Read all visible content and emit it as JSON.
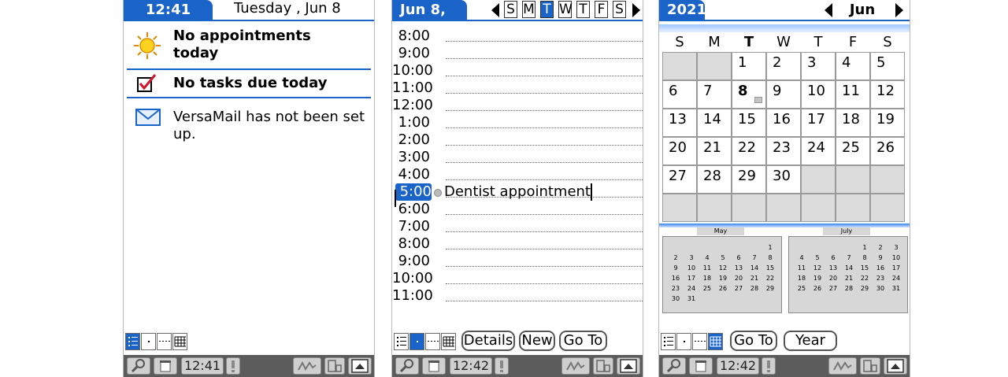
{
  "s1": {
    "time_tab": "12:41 pm",
    "date": "Tuesday , Jun 8",
    "appointments": "No appointments today",
    "appointments_l1": "No appointments",
    "appointments_l2": "today",
    "tasks": "No tasks due today",
    "mail": "VersaMail has not been set up.",
    "status_time": "12:41",
    "icons": [
      "sun-icon",
      "checkbox-icon",
      "envelope-icon"
    ]
  },
  "s2": {
    "date_tab": "Jun 8, 21",
    "week_days": [
      "S",
      "M",
      "T",
      "W",
      "T",
      "F",
      "S"
    ],
    "selected_day_index": 2,
    "hours": [
      "8:00",
      "9:00",
      "10:00",
      "11:00",
      "12:00",
      "1:00",
      "2:00",
      "3:00",
      "4:00",
      "5:00",
      "6:00",
      "7:00",
      "8:00",
      "9:00",
      "10:00",
      "11:00"
    ],
    "selected_hour_index": 9,
    "event_text": "Dentist appointment",
    "buttons": {
      "details": "Details",
      "new": "New",
      "goto": "Go To"
    },
    "status_time": "12:42"
  },
  "s3": {
    "year_tab": "2021",
    "month": "Jun",
    "dow": [
      "S",
      "M",
      "T",
      "W",
      "T",
      "F",
      "S"
    ],
    "weeks": [
      [
        "",
        "",
        "1",
        "2",
        "3",
        "4",
        "5"
      ],
      [
        "6",
        "7",
        "8",
        "9",
        "10",
        "11",
        "12"
      ],
      [
        "13",
        "14",
        "15",
        "16",
        "17",
        "18",
        "19"
      ],
      [
        "20",
        "21",
        "22",
        "23",
        "24",
        "25",
        "26"
      ],
      [
        "27",
        "28",
        "29",
        "30",
        "",
        "",
        ""
      ],
      [
        "",
        "",
        "",
        "",
        "",
        "",
        ""
      ]
    ],
    "today": "8",
    "prev_month": {
      "name": "May",
      "days": [
        "",
        "",
        "",
        "",
        "",
        "",
        "1",
        "2",
        "3",
        "4",
        "5",
        "6",
        "7",
        "8",
        "9",
        "10",
        "11",
        "12",
        "13",
        "14",
        "15",
        "16",
        "17",
        "18",
        "19",
        "20",
        "21",
        "22",
        "23",
        "24",
        "25",
        "26",
        "27",
        "28",
        "29",
        "30",
        "31"
      ]
    },
    "next_month": {
      "name": "July",
      "days": [
        "",
        "",
        "",
        "",
        "1",
        "2",
        "3",
        "4",
        "5",
        "6",
        "7",
        "8",
        "9",
        "10",
        "11",
        "12",
        "13",
        "14",
        "15",
        "16",
        "17",
        "18",
        "19",
        "20",
        "21",
        "22",
        "23",
        "24",
        "25",
        "26",
        "27",
        "28",
        "29",
        "30",
        "31"
      ]
    },
    "buttons": {
      "goto": "Go To",
      "year": "Year"
    },
    "status_time": "12:42"
  },
  "colors": {
    "accent": "#1a63c9",
    "status_bar": "#5c5c5c",
    "empty_cell": "#dcdcdc"
  }
}
